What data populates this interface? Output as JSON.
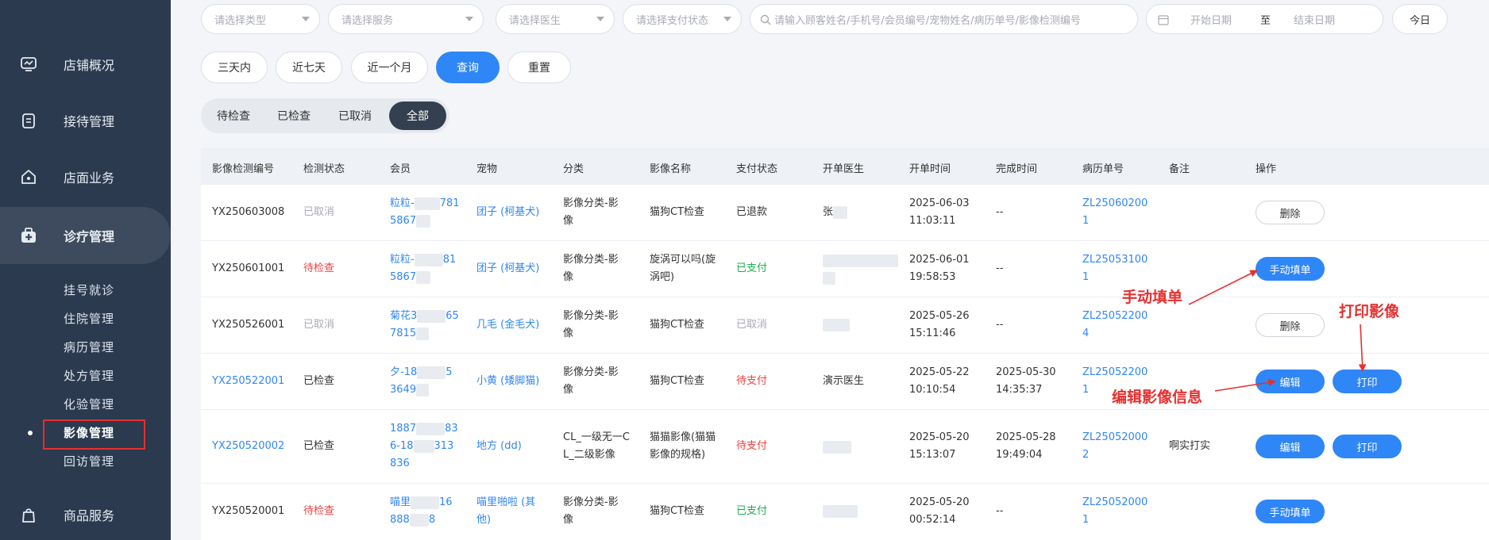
{
  "sidebar": {
    "menu": [
      {
        "label": "店铺概况",
        "icon": "monitor-icon"
      },
      {
        "label": "接待管理",
        "icon": "clipboard-icon"
      },
      {
        "label": "店面业务",
        "icon": "house-icon"
      },
      {
        "label": "诊疗管理",
        "icon": "medical-kit-icon"
      },
      {
        "label": "商品服务",
        "icon": "bag-icon"
      }
    ],
    "submenu": [
      "挂号就诊",
      "住院管理",
      "病历管理",
      "处方管理",
      "化验管理",
      "影像管理",
      "回访管理"
    ]
  },
  "filters": {
    "type_placeholder": "请选择类型",
    "service_placeholder": "请选择服务",
    "doctor_placeholder": "请选择医生",
    "pay_placeholder": "请选择支付状态",
    "search_placeholder": "请输入顾客姓名/手机号/会员编号/宠物姓名/病历单号/影像检测编号",
    "start_date": "开始日期",
    "to": "至",
    "end_date": "结束日期",
    "today": "今日",
    "range_3d": "三天内",
    "range_7d": "近七天",
    "range_1m": "近一个月",
    "query": "查询",
    "reset": "重置"
  },
  "tabs": [
    "待检查",
    "已检查",
    "已取消",
    "全部"
  ],
  "table": {
    "headers": [
      "影像检测编号",
      "检测状态",
      "会员",
      "宠物",
      "分类",
      "影像名称",
      "支付状态",
      "开单医生",
      "开单时间",
      "完成时间",
      "病历单号",
      "备注",
      "操作"
    ],
    "rows": [
      {
        "id": "YX250603008",
        "status": "已取消",
        "member1": "粒粒-",
        "member1b": "781",
        "member2": "5867",
        "pet": "团子 (柯基犬)",
        "cat1": "影像分类-影",
        "cat2": "像",
        "name1": "猫狗CT检查",
        "name2": "",
        "pay": "已退款",
        "doctor": "张",
        "time1": "2025-06-03",
        "time2": "11:03:11",
        "done1": "--",
        "done2": "",
        "record1": "ZL25060200",
        "record2": "1",
        "note": "",
        "actions": [
          "删除"
        ]
      },
      {
        "id": "YX250601001",
        "status": "待检查",
        "member1": "粒粒-",
        "member1b": "81",
        "member2": "5867",
        "pet": "团子 (柯基犬)",
        "cat1": "影像分类-影",
        "cat2": "像",
        "name1": "旋涡可以吗(旋",
        "name2": "涡吧)",
        "pay": "已支付",
        "doctor": "",
        "time1": "2025-06-01",
        "time2": "19:58:53",
        "done1": "--",
        "done2": "",
        "record1": "ZL25053100",
        "record2": "1",
        "note": "",
        "actions": [
          "手动填单"
        ]
      },
      {
        "id": "YX250526001",
        "status": "已取消",
        "member1": "菊花3",
        "member1b": "65",
        "member2": "7815",
        "pet": "几毛 (金毛犬)",
        "cat1": "影像分类-影",
        "cat2": "像",
        "name1": "猫狗CT检查",
        "name2": "",
        "pay": "已取消",
        "doctor": "",
        "time1": "2025-05-26",
        "time2": "15:11:46",
        "done1": "--",
        "done2": "",
        "record1": "ZL25052200",
        "record2": "4",
        "note": "",
        "actions": [
          "删除"
        ]
      },
      {
        "id": "YX250522001",
        "status": "已检查",
        "member1": "夕-18",
        "member1b": "5",
        "member2": "3649",
        "pet": "小黄 (矮脚猫)",
        "cat1": "影像分类-影",
        "cat2": "像",
        "name1": "猫狗CT检查",
        "name2": "",
        "pay": "待支付",
        "doctor": "演示医生",
        "time1": "2025-05-22",
        "time2": "10:10:54",
        "done1": "2025-05-30",
        "done2": "14:35:37",
        "record1": "ZL25052200",
        "record2": "1",
        "note": "",
        "actions": [
          "编辑",
          "打印"
        ]
      },
      {
        "id": "YX250520002",
        "status": "已检查",
        "member1": "1887",
        "member1b": "83",
        "member2": "6-18",
        "member2b": "313",
        "member3": "836",
        "pet": "地方 (dd)",
        "cat1": "CL_一级无一C",
        "cat2": "L_二级影像",
        "name1": "猫猫影像(猫猫",
        "name2": "影像的规格)",
        "pay": "待支付",
        "doctor": "",
        "time1": "2025-05-20",
        "time2": "15:13:07",
        "done1": "2025-05-28",
        "done2": "19:49:04",
        "record1": "ZL25052000",
        "record2": "2",
        "note": "啊实打实",
        "actions": [
          "编辑",
          "打印"
        ]
      },
      {
        "id": "YX250520001",
        "status": "待检查",
        "member1": "喵里",
        "member1b": "16",
        "member2": "888",
        "member2b": "8",
        "pet": "喵里啪啦 (其",
        "pet2": "他)",
        "cat1": "影像分类-影",
        "cat2": "像",
        "name1": "猫狗CT检查",
        "name2": "",
        "pay": "已支付",
        "doctor": "",
        "time1": "2025-05-20",
        "time2": "00:52:14",
        "done1": "--",
        "done2": "",
        "record1": "ZL25052000",
        "record2": "1",
        "note": "",
        "actions": [
          "手动填单"
        ]
      }
    ]
  },
  "annotations": {
    "manual_fill": "手动填单",
    "print_image": "打印影像",
    "edit_info": "编辑影像信息"
  },
  "colors": {
    "sidebar_bg": "#2b3a4f",
    "primary": "#2f86f6",
    "annotation": "#e53030",
    "status_pending": "#f04040",
    "status_paid": "#19b14b"
  }
}
